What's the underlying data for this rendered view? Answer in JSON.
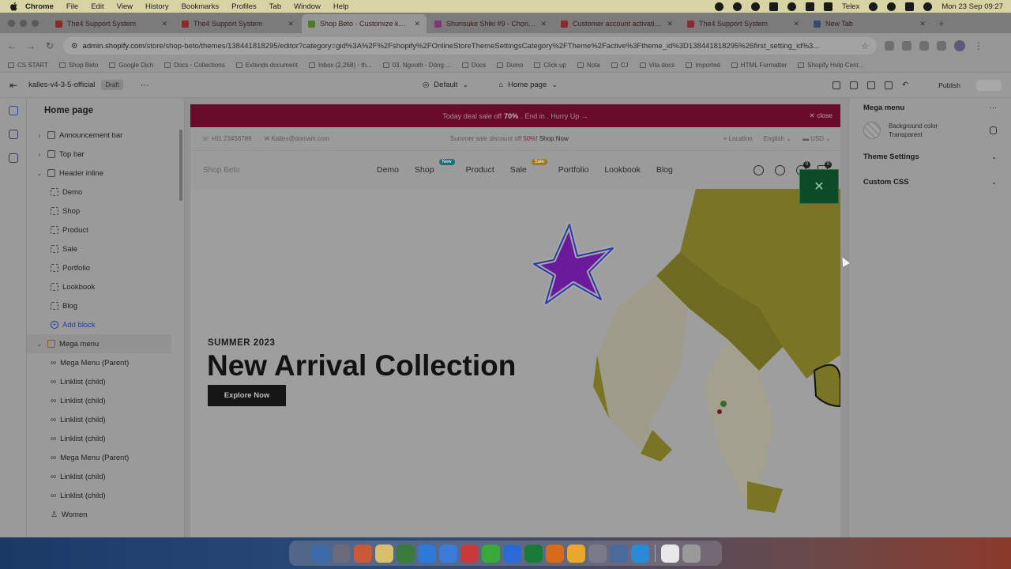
{
  "menubar": {
    "app": "Chrome",
    "items": [
      "File",
      "Edit",
      "View",
      "History",
      "Bookmarks",
      "Profiles",
      "Tab",
      "Window",
      "Help"
    ],
    "input_method": "Telex",
    "clock": "Mon 23 Sep  09:27"
  },
  "tabs": [
    {
      "title": "The4 Support System",
      "color": "#8a2a2a",
      "active": false
    },
    {
      "title": "The4 Support System",
      "color": "#8a2a2a",
      "active": false
    },
    {
      "title": "Shop Beto · Customize kalles",
      "color": "#4a7a2a",
      "active": true
    },
    {
      "title": "Shunsuke Shiki #9 - Chọn tra",
      "color": "#7a3a7a",
      "active": false
    },
    {
      "title": "Customer account activation",
      "color": "#8a2a2a",
      "active": false
    },
    {
      "title": "The4 Support System",
      "color": "#8a2a2a",
      "active": false
    },
    {
      "title": "New Tab",
      "color": "#3a4a6a",
      "active": false
    }
  ],
  "address": {
    "host": "admin.shopify.com",
    "path": "/store/shop-beto/themes/138441818295/editor?category=gid%3A%2F%2Fshopify%2FOnlineStoreThemeSettingsCategory%2FTheme%2Factive%3Ftheme_id%3D138441818295%26first_setting_id%3..."
  },
  "bookmarks": [
    "CS START",
    "Shop Beto",
    "Google Dịch",
    "Docs - Collections",
    "Extends document",
    "Inbox (2,268) - th...",
    "03. Ngooth - Dòng ...",
    "Docs",
    "Dumo",
    "Click up",
    "Nota",
    "CJ",
    "Vita docs",
    "Imported",
    "HTML Formatter",
    "Shopify Help Cent..."
  ],
  "editor": {
    "theme_name": "kalles-v4-3-5-official",
    "status": "Draft",
    "preset": "Default",
    "page": "Home page",
    "publish_label": "Publish"
  },
  "sidebar": {
    "title": "Home page",
    "sections": [
      {
        "label": "Announcement bar",
        "type": "section"
      },
      {
        "label": "Top bar",
        "type": "section"
      },
      {
        "label": "Header inline",
        "type": "section-open"
      },
      {
        "label": "Demo",
        "type": "child"
      },
      {
        "label": "Shop",
        "type": "child"
      },
      {
        "label": "Product",
        "type": "child"
      },
      {
        "label": "Sale",
        "type": "child"
      },
      {
        "label": "Portfolio",
        "type": "child"
      },
      {
        "label": "Lookbook",
        "type": "child"
      },
      {
        "label": "Blog",
        "type": "child"
      },
      {
        "label": "Add block",
        "type": "add"
      },
      {
        "label": "Mega menu",
        "type": "selected"
      },
      {
        "label": "Mega Menu (Parent)",
        "type": "link"
      },
      {
        "label": "Linklist (child)",
        "type": "link"
      },
      {
        "label": "Linklist (child)",
        "type": "link"
      },
      {
        "label": "Linklist (child)",
        "type": "link"
      },
      {
        "label": "Linklist (child)",
        "type": "link"
      },
      {
        "label": "Mega Menu (Parent)",
        "type": "link"
      },
      {
        "label": "Linklist (child)",
        "type": "link"
      },
      {
        "label": "Linklist (child)",
        "type": "link"
      },
      {
        "label": "Women",
        "type": "person"
      }
    ]
  },
  "store": {
    "announcement": {
      "pre": "Today deal sale off",
      "pct": "70%",
      "post": ". End in . Hurry Up →",
      "close": "close"
    },
    "topbar": {
      "phone": "+01 23456789",
      "email": "Kalles@domain.com",
      "promo_pre": "Summer sale discount off",
      "promo_pct": "50%!",
      "promo_link": "Shop Now",
      "location": "Location",
      "language": "English",
      "currency": "USD"
    },
    "logo": "Shop Beto",
    "nav": [
      {
        "label": "Demo"
      },
      {
        "label": "Shop",
        "badge": "New",
        "badge_type": "new"
      },
      {
        "label": "Product"
      },
      {
        "label": "Sale",
        "badge": "Sale",
        "badge_type": "sale"
      },
      {
        "label": "Portfolio"
      },
      {
        "label": "Lookbook"
      },
      {
        "label": "Blog"
      }
    ],
    "wishlist_count": "0",
    "cart_count": "0",
    "hero": {
      "eyebrow": "SUMMER 2023",
      "title": "New Arrival Collection",
      "cta": "Explore Now"
    }
  },
  "settings": {
    "title": "Mega menu",
    "bg_label": "Background color",
    "bg_value": "Transparent",
    "accordions": [
      "Theme Settings",
      "Custom CSS"
    ]
  },
  "dock": {
    "apps": [
      "finder",
      "launchpad",
      "photos",
      "notes",
      "chrome",
      "app-store",
      "zalo",
      "chrome-alt",
      "wechat",
      "safari",
      "excel",
      "sublime",
      "sketch",
      "settings",
      "files",
      "zalo-alt",
      "notes-alt",
      "trash"
    ]
  }
}
